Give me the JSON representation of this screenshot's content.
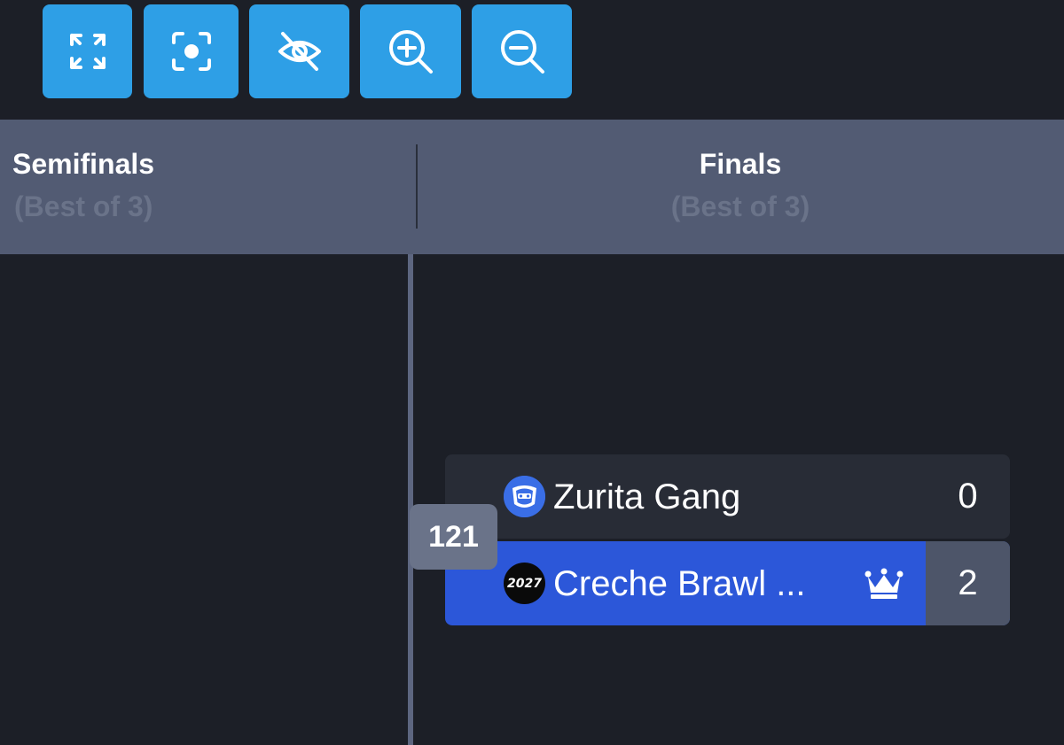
{
  "toolbar": {
    "buttons": [
      {
        "name": "fullscreen",
        "icon": "expand-icon"
      },
      {
        "name": "recenter",
        "icon": "focus-icon"
      },
      {
        "name": "hide",
        "icon": "eye-off-icon"
      },
      {
        "name": "zoom-in",
        "icon": "zoom-in-icon"
      },
      {
        "name": "zoom-out",
        "icon": "zoom-out-icon"
      }
    ],
    "color": "#2e9fe6"
  },
  "rounds": [
    {
      "title": "Semifinals",
      "subtitle": "(Best of 3)"
    },
    {
      "title": "Finals",
      "subtitle": "(Best of 3)"
    }
  ],
  "match": {
    "id": "121",
    "teams": [
      {
        "name": "Zurita Gang",
        "score": "0",
        "logo": "brawl-star-logo",
        "winner": false
      },
      {
        "name": "Creche Brawl ...",
        "score": "2",
        "logo": "2027-logo",
        "logo_text": "2027",
        "winner": true
      }
    ],
    "winner_color": "#2c57d9"
  }
}
